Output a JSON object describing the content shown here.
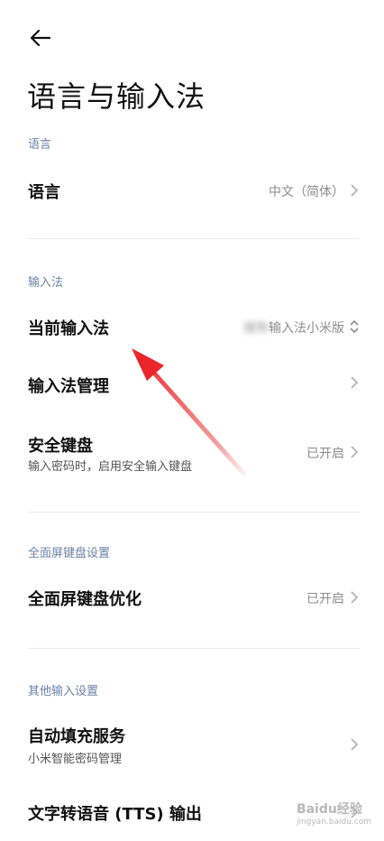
{
  "header": {
    "back_icon": "arrow-left-icon",
    "title": "语言与输入法"
  },
  "sections": {
    "language": {
      "label": "语言",
      "rows": [
        {
          "title": "语言",
          "value": "中文（简体）"
        }
      ]
    },
    "input_method": {
      "label": "输入法",
      "rows": [
        {
          "title": "当前输入法",
          "value_blurred": "搜狗",
          "value": "输入法小米版"
        },
        {
          "title": "输入法管理"
        },
        {
          "title": "安全键盘",
          "subtitle": "输入密码时，启用安全输入键盘",
          "value": "已开启"
        }
      ]
    },
    "fullscreen_keyboard": {
      "label": "全面屏键盘设置",
      "rows": [
        {
          "title": "全面屏键盘优化",
          "value": "已开启"
        }
      ]
    },
    "other": {
      "label": "其他输入设置",
      "rows": [
        {
          "title": "自动填充服务",
          "subtitle": "小米智能密码管理"
        },
        {
          "title": "文字转语音 (TTS) 输出"
        }
      ]
    }
  },
  "annotation": {
    "color": "#e8262a"
  },
  "watermark": {
    "main": "Baidu经验",
    "sub": "jingyan.baidu.com"
  }
}
